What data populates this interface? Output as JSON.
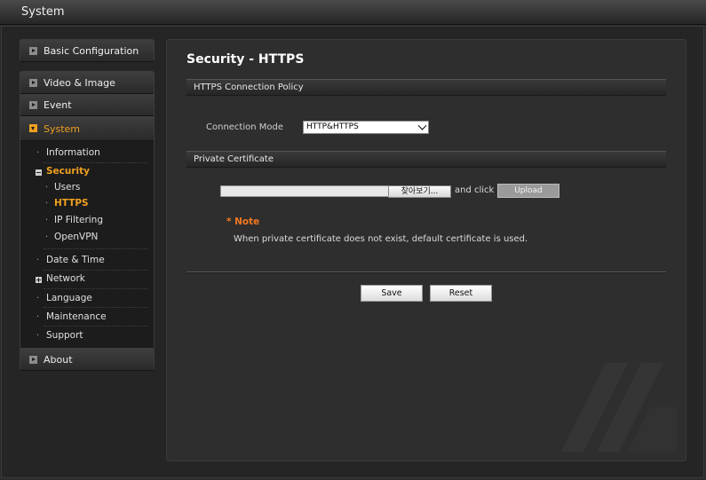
{
  "window": {
    "title": "System"
  },
  "sidebar": {
    "basic_configuration": "Basic Configuration",
    "video_image": "Video & Image",
    "event": "Event",
    "system": "System",
    "sub": {
      "information": "Information",
      "security": "Security",
      "security_items": {
        "users": "Users",
        "https": "HTTPS",
        "ip_filtering": "IP Filtering",
        "openvpn": "OpenVPN"
      },
      "date_time": "Date & Time",
      "network": "Network",
      "language": "Language",
      "maintenance": "Maintenance",
      "support": "Support"
    },
    "about": "About",
    "bullet": "·"
  },
  "main": {
    "title": "Security - HTTPS",
    "sections": {
      "policy": "HTTPS Connection Policy",
      "certificate": "Private Certificate"
    },
    "connection_mode": {
      "label": "Connection Mode",
      "value": "HTTP&HTTPS"
    },
    "file": {
      "browse_label": "찾아보기...",
      "and_click": "and click",
      "upload_label": "Upload"
    },
    "note": {
      "title": "* Note",
      "text": "When private certificate does not exist, default certificate is used."
    },
    "buttons": {
      "save": "Save",
      "reset": "Reset"
    }
  },
  "colors": {
    "accent": "#f0a020",
    "note": "#f07820",
    "background": "#2b2b2b"
  }
}
